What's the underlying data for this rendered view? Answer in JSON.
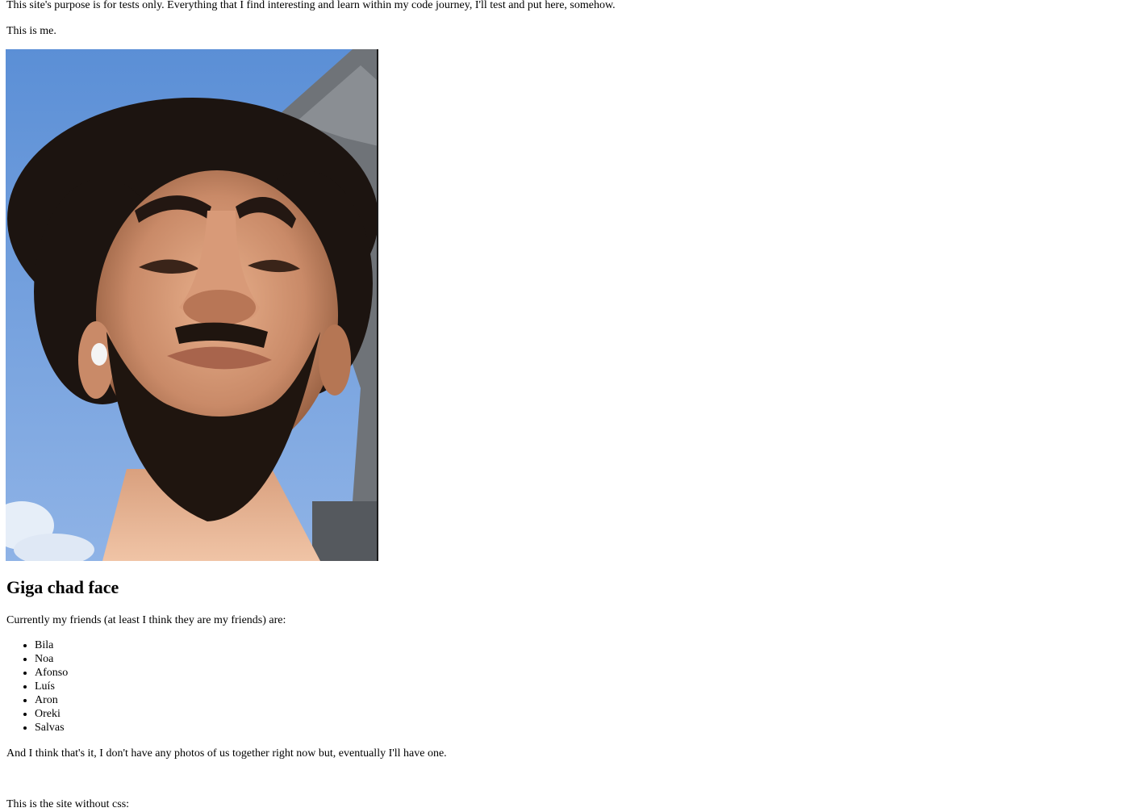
{
  "intro": "This site's purpose is for tests only. Everything that I find interesting and learn within my code journey, I'll test and put here, somehow.",
  "me_caption": "This is me.",
  "heading": "Giga chad face",
  "friends_intro": "Currently my friends (at least I think they are my friends) are:",
  "friends": [
    "Bila",
    "Noa",
    "Afonso",
    "Luís",
    "Aron",
    "Oreki",
    "Salvas"
  ],
  "closing": "And I think that's it, I don't have any photos of us together right now but, eventually I'll have one.",
  "nocss": "This is the site without css:"
}
